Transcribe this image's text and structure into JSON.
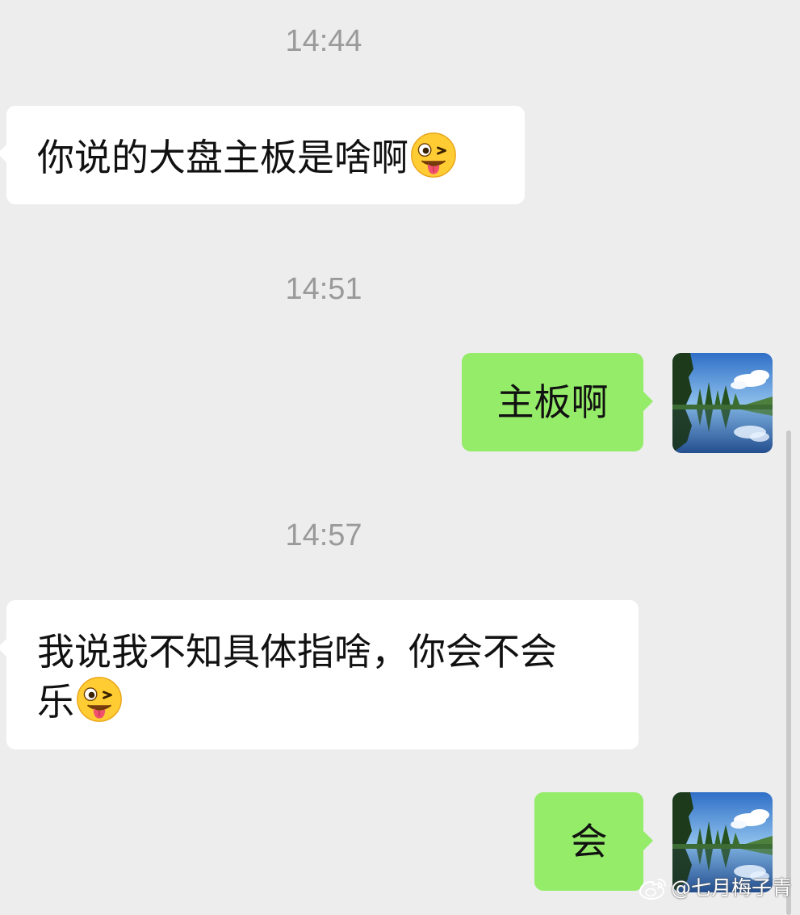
{
  "chat": {
    "messages": [
      {
        "type": "time",
        "text": "14:44"
      },
      {
        "type": "incoming",
        "text": "你说的大盘主板是啥啊",
        "emoji": "wink-tongue-emoji"
      },
      {
        "type": "time",
        "text": "14:51"
      },
      {
        "type": "outgoing",
        "text": "主板啊",
        "avatar": "landscape-lake-avatar"
      },
      {
        "type": "time",
        "text": "14:57"
      },
      {
        "type": "incoming",
        "line1": "我说我不知具体指啥，你会不会",
        "line2": "乐",
        "emoji": "wink-tongue-emoji"
      },
      {
        "type": "outgoing",
        "text": "会",
        "avatar": "landscape-lake-avatar"
      }
    ]
  },
  "watermark": {
    "text": "@七月梅子青",
    "icon": "weibo-icon"
  },
  "colors": {
    "background": "#ededed",
    "incoming_bubble": "#ffffff",
    "outgoing_bubble": "#95ec69",
    "timestamp": "#9a9a9a"
  }
}
